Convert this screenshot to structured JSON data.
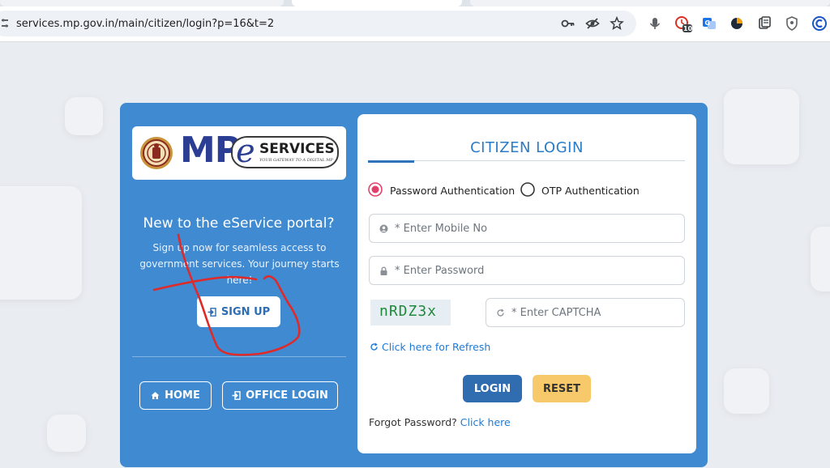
{
  "browser": {
    "url": "services.mp.gov.in/main/citizen/login?p=16&t=2",
    "extension_badge": "10",
    "icons": [
      "site-info-icon",
      "key-icon",
      "eye-off-icon",
      "star-icon",
      "mic-icon",
      "extension-icon",
      "translate-icon",
      "extension-icon",
      "extension-icon",
      "shield-icon",
      "c-extension-icon"
    ]
  },
  "brand": {
    "mp": "MP",
    "e": "e",
    "services": "SERVICES",
    "tagline": "YOUR GATEWAY TO A DIGITAL MP"
  },
  "signup_section": {
    "heading": "New to the eService portal?",
    "subtext": "Sign up now for seamless access to government services. Your journey starts here!",
    "signup_label": "SIGN UP"
  },
  "nav": {
    "home_label": "HOME",
    "office_login_label": "OFFICE LOGIN"
  },
  "login": {
    "title": "CITIZEN LOGIN",
    "auth_password": "Password Authentication",
    "auth_otp": "OTP Authentication",
    "selected_auth": "password",
    "mobile_placeholder": "* Enter Mobile No",
    "password_placeholder": "* Enter Password",
    "captcha_code": "nRDZ3x",
    "captcha_placeholder": "* Enter CAPTCHA",
    "refresh_label": "Click here for Refresh",
    "login_label": "LOGIN",
    "reset_label": "RESET",
    "forgot_text": "Forgot Password?",
    "forgot_link": "Click here"
  },
  "colors": {
    "card_blue": "#3f8ad0",
    "accent": "#2a7cc8",
    "reset_yellow": "#f7c96b",
    "annotation_red": "#e02a2a"
  }
}
